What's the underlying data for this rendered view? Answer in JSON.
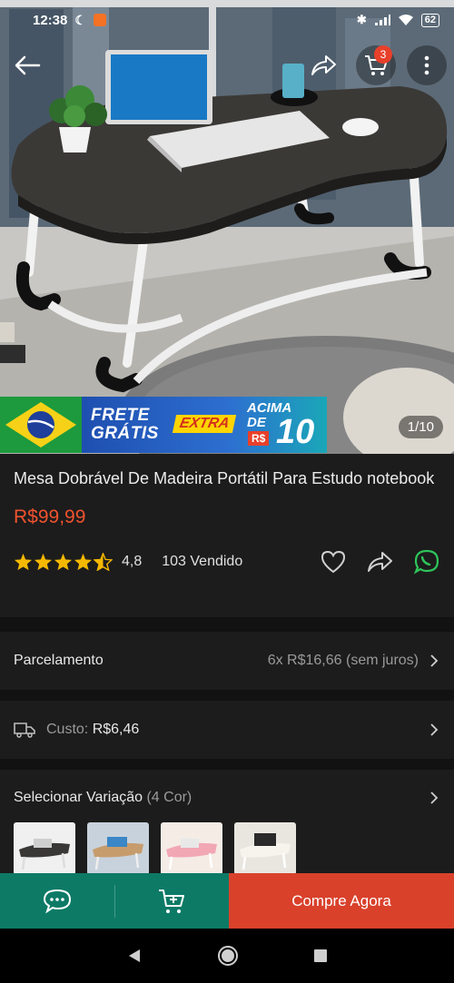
{
  "status_bar": {
    "time": "12:38",
    "battery": "62"
  },
  "header": {
    "cart_count": "3"
  },
  "promo": {
    "frete": "FRETE",
    "gratis": "GRÁTIS",
    "extra": "EXTRA",
    "acima": "ACIMA",
    "de": "DE",
    "currency": "R$",
    "amount": "10"
  },
  "gallery": {
    "counter": "1/10"
  },
  "product": {
    "title": "Mesa Dobrável De Madeira Portátil Para Estudo notebook",
    "price": "R$99,99",
    "rating": "4,8",
    "rating_value": 4.5,
    "sold": "103 Vendido"
  },
  "installments": {
    "label": "Parcelamento",
    "value": "6x R$16,66 (sem juros)"
  },
  "shipping": {
    "label": "Custo:",
    "value": "R$6,46"
  },
  "variation": {
    "label": "Selecionar Variação",
    "count": "(4 Cor)"
  },
  "bottom_bar": {
    "buy_label": "Compre Agora"
  },
  "colors": {
    "accent": "#f0522f",
    "buy": "#d9412b",
    "chat_cart": "#0d7a66",
    "star": "#f5b800",
    "whatsapp": "#2ec45a"
  }
}
